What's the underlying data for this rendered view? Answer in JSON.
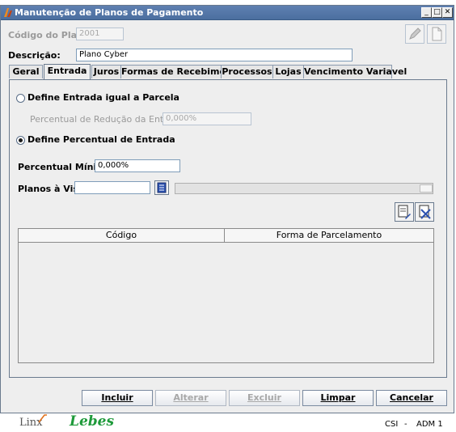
{
  "window": {
    "title": "Manutenção de Planos de Pagamento",
    "minimize_glyph": "_",
    "maximize_glyph": "□",
    "close_glyph": "✕"
  },
  "form": {
    "codigo_label": "Código do Plano:",
    "codigo_value": "2001",
    "descricao_label": "Descrição:",
    "descricao_value": "Plano Cyber"
  },
  "tabs": [
    {
      "label": "Geral"
    },
    {
      "label": "Entrada"
    },
    {
      "label": "Juros"
    },
    {
      "label": "Formas de Recebimento"
    },
    {
      "label": "Processos"
    },
    {
      "label": "Lojas"
    },
    {
      "label": "Vencimento Variavel"
    }
  ],
  "active_tab": "Entrada",
  "entrada": {
    "radio_parcela_label": "Define Entrada igual a Parcela",
    "reducao_label": "Percentual de Redução da Entrada:",
    "reducao_value": "0,000%",
    "radio_percentual_label": "Define Percentual de Entrada",
    "minimo_label": "Percentual Mínimo:",
    "minimo_value": "0,000%",
    "planos_label": "Planos à Vista:",
    "planos_value": ""
  },
  "table": {
    "headers": [
      "Código",
      "Forma de Parcelamento"
    ],
    "rows": []
  },
  "buttons": {
    "incluir": "Incluir",
    "alterar": "Alterar",
    "excluir": "Excluir",
    "limpar": "Limpar",
    "cancelar": "Cancelar"
  },
  "footer": {
    "brand1": "Linx",
    "brand2": "Lebes",
    "status_left": "CSI",
    "status_sep": "-",
    "status_right": "ADM 1"
  },
  "colors": {
    "titlebar": "#5f80b1",
    "panel_bg": "#eeeeee",
    "field_border": "#7f9db9",
    "lebes_green": "#1e9a3a",
    "linx_orange": "#e0701a"
  }
}
